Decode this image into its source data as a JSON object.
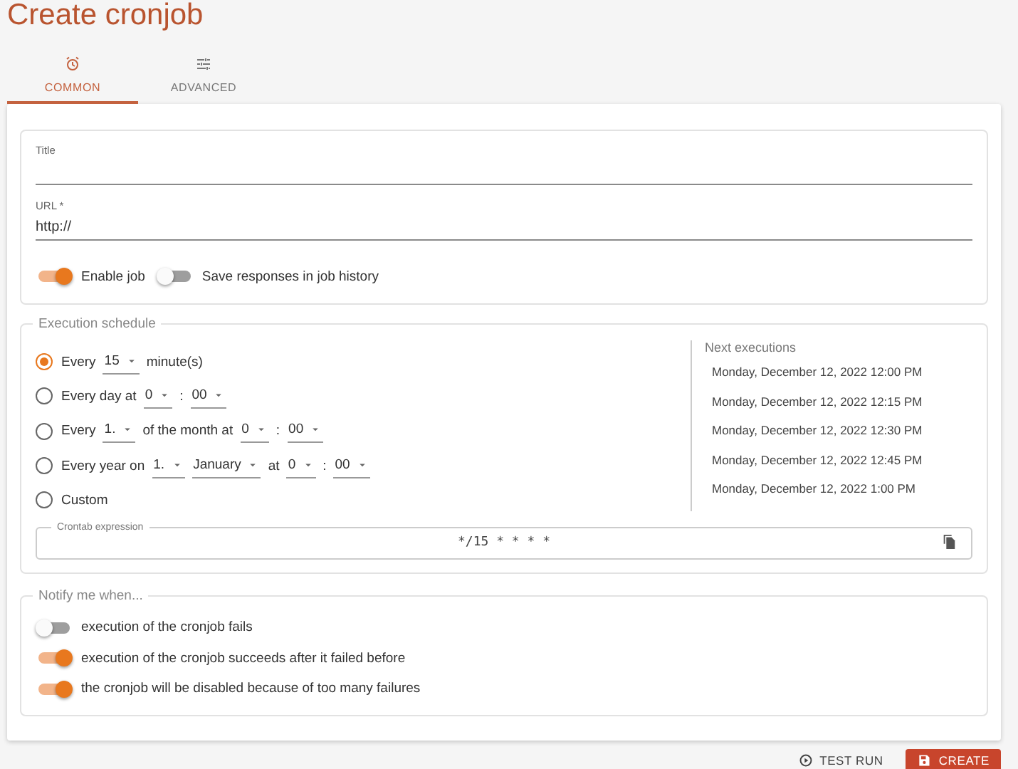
{
  "page_title": "Create cronjob",
  "tabs": [
    {
      "label": "COMMON",
      "selected": true
    },
    {
      "label": "ADVANCED",
      "selected": false
    }
  ],
  "general": {
    "title_field": {
      "label": "Title"
    },
    "url_field": {
      "label": "URL *",
      "value": "http://"
    },
    "toggles": [
      {
        "label": "Enable job",
        "on": true
      },
      {
        "label": "Save responses in job history",
        "on": false
      }
    ]
  },
  "schedule": {
    "legend": "Execution schedule",
    "options": [
      {
        "selected": true,
        "parts": [
          {
            "kind": "text",
            "text": "Every"
          },
          {
            "kind": "select",
            "value": "15"
          },
          {
            "kind": "text",
            "text": "minute(s)"
          }
        ]
      },
      {
        "selected": false,
        "parts": [
          {
            "kind": "text",
            "text": "Every day at"
          },
          {
            "kind": "select",
            "value": "0"
          },
          {
            "kind": "text",
            "text": ":"
          },
          {
            "kind": "select",
            "value": "00"
          }
        ]
      },
      {
        "selected": false,
        "parts": [
          {
            "kind": "text",
            "text": "Every"
          },
          {
            "kind": "select",
            "value": "1."
          },
          {
            "kind": "text",
            "text": "of the month at"
          },
          {
            "kind": "select",
            "value": "0"
          },
          {
            "kind": "text",
            "text": ":"
          },
          {
            "kind": "select",
            "value": "00"
          }
        ]
      },
      {
        "selected": false,
        "parts": [
          {
            "kind": "text",
            "text": "Every year on"
          },
          {
            "kind": "select",
            "value": "1."
          },
          {
            "kind": "select",
            "value": "January"
          },
          {
            "kind": "text",
            "text": "at"
          },
          {
            "kind": "select",
            "value": "0"
          },
          {
            "kind": "text",
            "text": ":"
          },
          {
            "kind": "select",
            "value": "00"
          }
        ]
      },
      {
        "selected": false,
        "parts": [
          {
            "kind": "text",
            "text": "Custom"
          }
        ]
      }
    ],
    "next_executions": {
      "heading": "Next executions",
      "items": [
        "Monday, December 12, 2022 12:00 PM",
        "Monday, December 12, 2022 12:15 PM",
        "Monday, December 12, 2022 12:30 PM",
        "Monday, December 12, 2022 12:45 PM",
        "Monday, December 12, 2022 1:00 PM"
      ]
    },
    "crontab": {
      "label": "Crontab expression",
      "value": "*/15 * * * *"
    }
  },
  "notify": {
    "legend": "Notify me when...",
    "items": [
      {
        "label": "execution of the cronjob fails",
        "on": false
      },
      {
        "label": "execution of the cronjob succeeds after it failed before",
        "on": true
      },
      {
        "label": "the cronjob will be disabled because of too many failures",
        "on": true
      }
    ]
  },
  "actions": [
    {
      "kind": "text",
      "label": "TEST RUN"
    },
    {
      "kind": "primary",
      "label": "CREATE"
    }
  ]
}
